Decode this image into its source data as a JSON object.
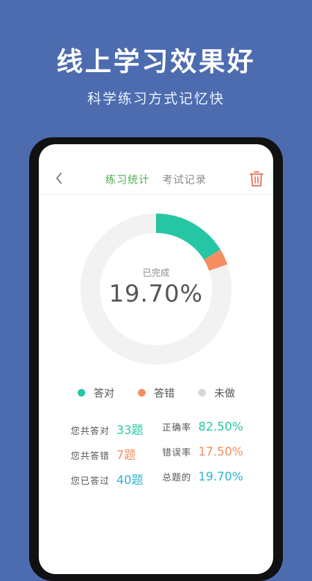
{
  "promo": {
    "headline": "线上学习效果好",
    "subline": "科学练习方式记忆快"
  },
  "header": {
    "tabs": [
      {
        "label": "练习统计",
        "active": true
      },
      {
        "label": "考试记录",
        "active": false
      }
    ],
    "back_icon": "chevron-left-icon",
    "trash_icon": "trash-icon"
  },
  "summary": {
    "caption": "已完成",
    "value": "19.70%"
  },
  "chart_data": {
    "type": "pie",
    "style": "donut",
    "categories": [
      "答对",
      "答错",
      "未做"
    ],
    "values": [
      16.25,
      3.45,
      80.3
    ],
    "colors": [
      "#26c6a4",
      "#f58d61",
      "#f2f2f2"
    ]
  },
  "legend": [
    {
      "label": "答对",
      "color": "#26c6a4"
    },
    {
      "label": "答错",
      "color": "#f58d61"
    },
    {
      "label": "未做",
      "color": "#d6d6d6"
    }
  ],
  "stats": {
    "left": [
      {
        "label": "您共答对",
        "value": "33题",
        "color": "#26c6a4"
      },
      {
        "label": "您共答错",
        "value": "7题",
        "color": "#f58d61"
      },
      {
        "label": "您已答过",
        "value": "40题",
        "color": "#2fb3cf"
      }
    ],
    "right": [
      {
        "label": "正确率",
        "value": "82.50%",
        "color": "#26c6a4"
      },
      {
        "label": "错误率",
        "value": "17.50%",
        "color": "#f58d61"
      },
      {
        "label": "总题的",
        "value": "19.70%",
        "color": "#2fb3cf"
      }
    ]
  }
}
